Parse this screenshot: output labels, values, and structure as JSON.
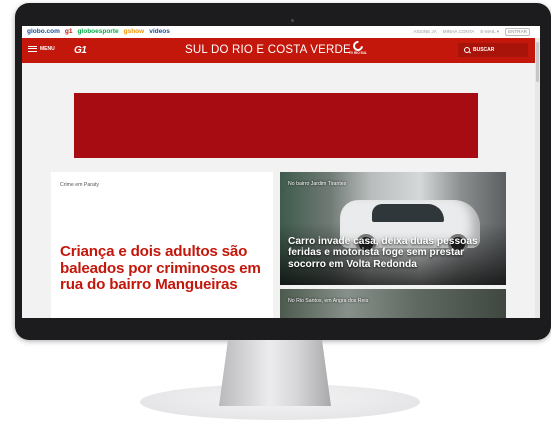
{
  "topbar": {
    "brands": [
      {
        "label": "globo.com",
        "color": "#1d4f91"
      },
      {
        "label": "g1",
        "color": "#c4170c"
      },
      {
        "label": "globoesporte",
        "color": "#06aa48"
      },
      {
        "label": "gshow",
        "color": "#f49500"
      },
      {
        "label": "vídeos",
        "color": "#1d4f91"
      }
    ],
    "links": [
      "ASSINE JÁ",
      "MINHA CONTA",
      "E-MAIL"
    ],
    "enter_button": "ENTRAR"
  },
  "header": {
    "menu_label": "MENU",
    "logo": "G1",
    "region": "SUL DO RIO E COSTA VERDE",
    "affiliate_label": "TV RIO SUL",
    "search_label": "BUSCAR",
    "color": "#c4170c"
  },
  "ad": {
    "color": "#a60c12"
  },
  "feed": {
    "left": {
      "kicker": "Crime em Paraty",
      "headline": "Criança e dois adultos são baleados por criminosos em rua do bairro Mangueiras"
    },
    "right1": {
      "kicker": "No bairro Jardim Tirantes",
      "headline": "Carro invade casa, deixa duas pessoas feridas e motorista foge sem prestar socorro em Volta Redonda"
    },
    "right2": {
      "kicker": "No Rio Santos, em Angra dos Reis"
    }
  }
}
